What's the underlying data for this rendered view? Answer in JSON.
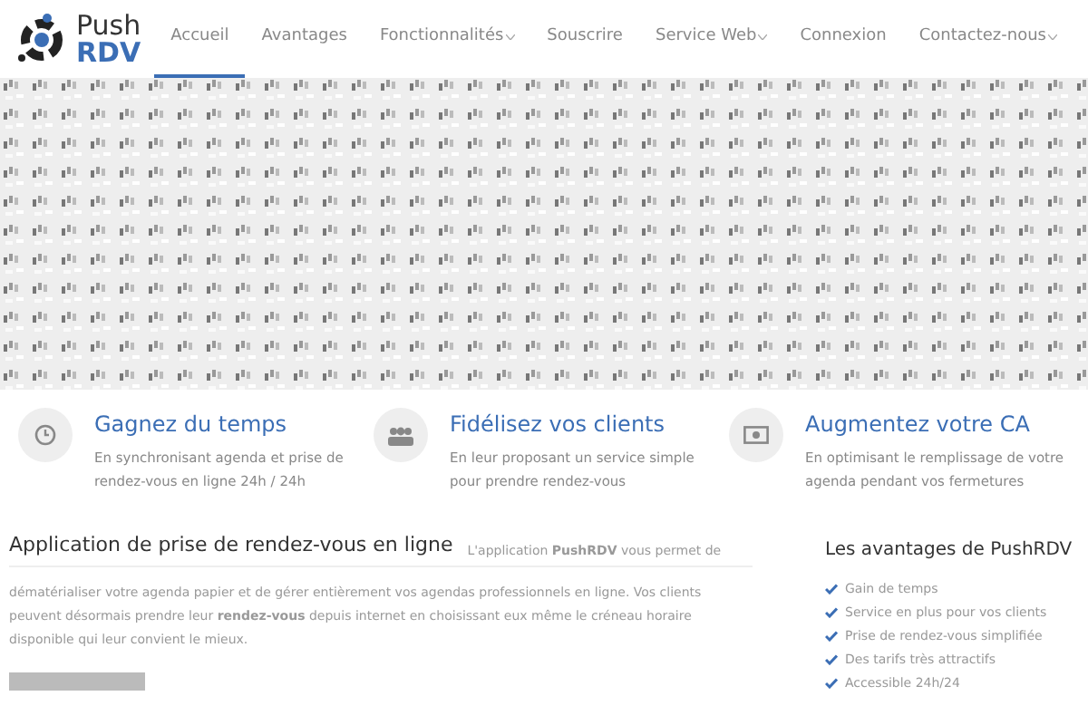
{
  "logo": {
    "line_1": "Push",
    "line_2": "RDV"
  },
  "nav": [
    {
      "label": "Accueil",
      "selected": true,
      "dropdown": false
    },
    {
      "label": "Avantages",
      "selected": false,
      "dropdown": false
    },
    {
      "label": "Fonctionnalités",
      "selected": false,
      "dropdown": true
    },
    {
      "label": "Souscrire",
      "selected": false,
      "dropdown": false
    },
    {
      "label": "Service Web",
      "selected": false,
      "dropdown": true
    },
    {
      "label": "Connexion",
      "selected": false,
      "dropdown": false
    },
    {
      "label": "Contactez-nous",
      "selected": false,
      "dropdown": true
    }
  ],
  "features": [
    {
      "kind": "clock",
      "title": "Gagnez du temps",
      "text": "En synchronisant agenda et prise de rendez-vous en ligne 24h / 24h"
    },
    {
      "kind": "group",
      "title": "Fidélisez vos clients",
      "text": "En leur proposant un service simple pour prendre rendez-vous"
    },
    {
      "kind": "money",
      "title": "Augmentez votre CA",
      "text": "En optimisant le remplissage de votre agenda pendant vos fermetures"
    }
  ],
  "intro": {
    "title": "Application de prise de rendez-vous en ligne",
    "lead": "L'application **PushRDV** vous permet de",
    "body": "dématérialiser votre agenda papier et de gérer entièrement vos agendas professionnels en ligne. Vos clients peuvent désormais prendre leur **rendez-vous** depuis internet en choisissant eux même le créneau horaire disponible qui leur convient le mieux."
  },
  "sidebar": {
    "title": "Les avantages de PushRDV",
    "items": [
      "Gain de temps",
      "Service en plus pour vos clients",
      "Prise de rendez-vous simplifiée",
      "Des tarifs très attractifs",
      "Accessible 24h/24"
    ]
  }
}
